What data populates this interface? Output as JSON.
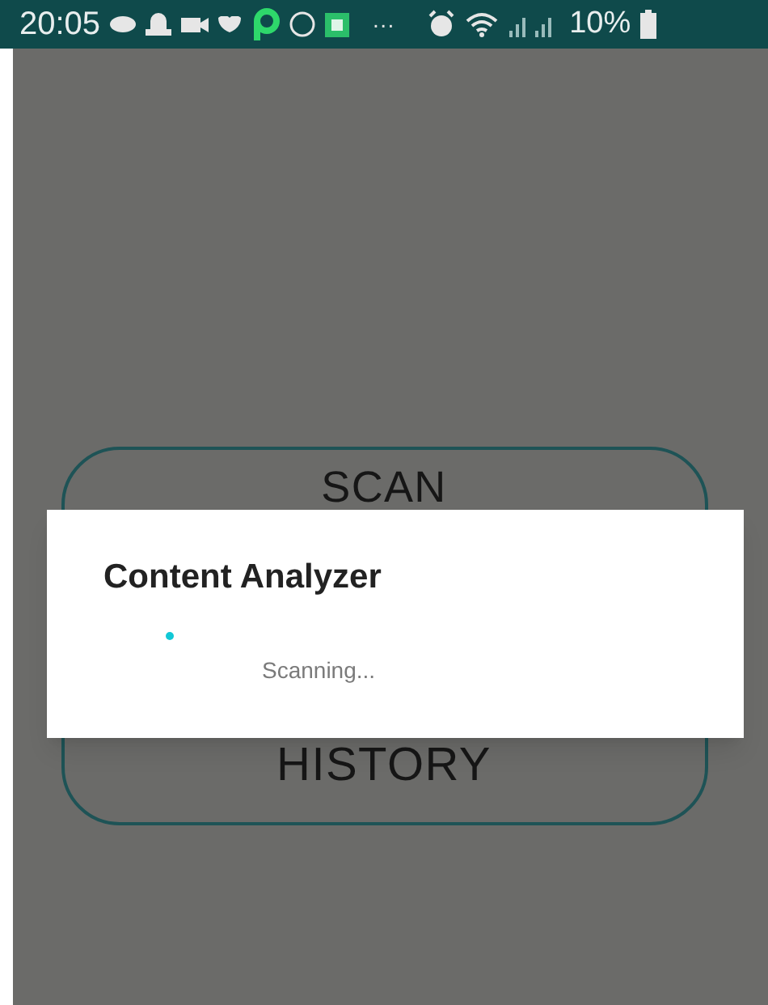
{
  "status_bar": {
    "time": "20:05",
    "overflow": "···",
    "battery_text": "10%"
  },
  "buttons": [
    "SCAN",
    "HISTORY"
  ],
  "dialog": {
    "title": "Content Analyzer",
    "message": "Scanning..."
  }
}
